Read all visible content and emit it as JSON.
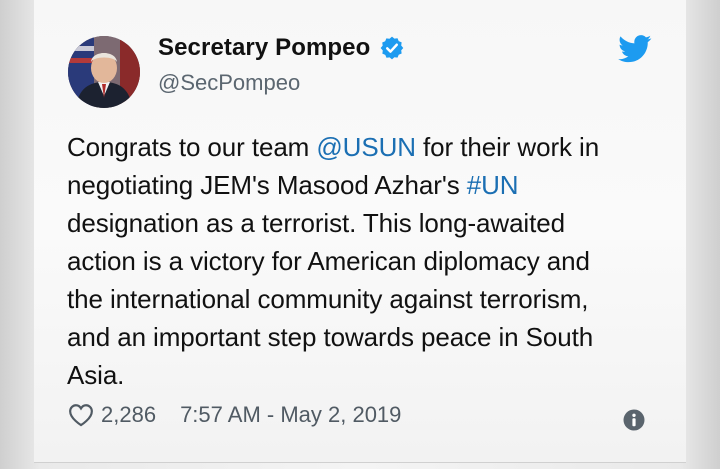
{
  "author": {
    "display_name": "Secretary Pompeo",
    "handle": "@SecPompeo",
    "verified": true,
    "avatar": "avatar-portrait"
  },
  "brand_icon": "twitter-bird-icon",
  "tweet": {
    "lines": [
      [
        {
          "text": "Congrats to our team "
        },
        {
          "text": "@USUN",
          "link": true
        },
        {
          "text": " for their work in"
        }
      ],
      [
        {
          "text": "negotiating JEM's Masood Azhar's "
        },
        {
          "text": "#UN",
          "link": true
        }
      ],
      [
        {
          "text": "designation as a terrorist. This long-awaited"
        }
      ],
      [
        {
          "text": "action is a victory for American diplomacy and"
        }
      ],
      [
        {
          "text": "the international community against terrorism,"
        }
      ],
      [
        {
          "text": "and an important step towards peace in South"
        }
      ],
      [
        {
          "text": "Asia."
        }
      ]
    ]
  },
  "footer": {
    "like_icon": "heart-icon",
    "likes": "2,286",
    "timestamp": "7:57 AM - May 2, 2019",
    "info_icon": "info-icon"
  },
  "colors": {
    "link": "#1b6fb3",
    "verified": "#1d9bf0",
    "twitter_brand": "#1d9bf0",
    "text": "#111111",
    "muted": "#5b6670"
  }
}
